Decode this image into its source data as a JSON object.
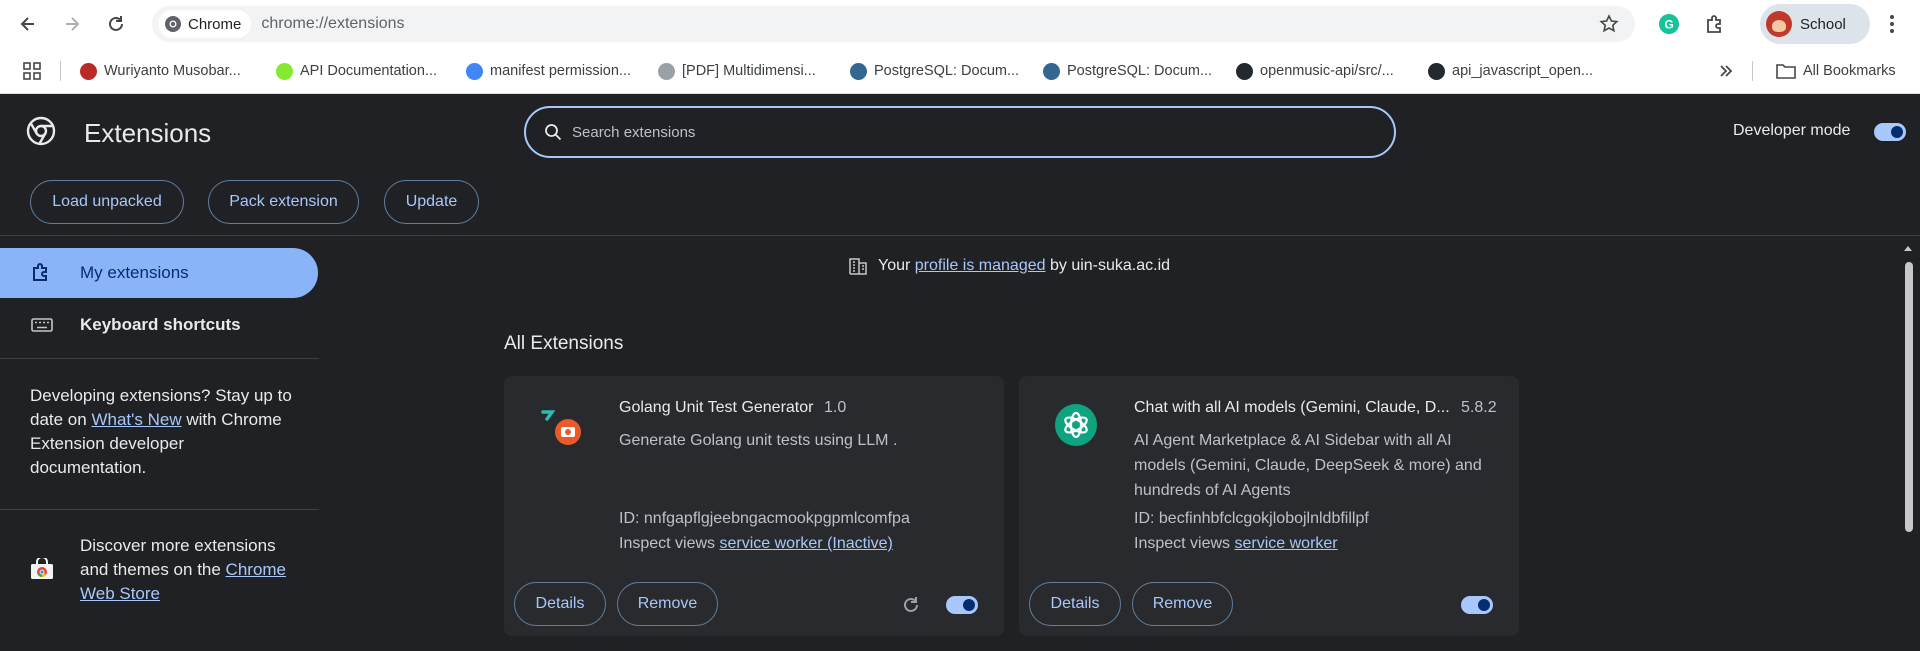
{
  "browser": {
    "chip_label": "Chrome",
    "url": "chrome://extensions",
    "profile_name": "School"
  },
  "bookmarks": [
    {
      "label": "Wuriyanto Musobar...",
      "icon": "quora-icon",
      "color": "#b92b27"
    },
    {
      "label": "API Documentation...",
      "icon": "api-icon",
      "color": "#85ea2d"
    },
    {
      "label": "manifest permission...",
      "icon": "google-icon",
      "color": "#4285f4"
    },
    {
      "label": "[PDF] Multidimensi...",
      "icon": "diamond-icon",
      "color": "#9aa0a6"
    },
    {
      "label": "PostgreSQL: Docum...",
      "icon": "postgres-icon",
      "color": "#336791"
    },
    {
      "label": "PostgreSQL: Docum...",
      "icon": "postgres-icon",
      "color": "#336791"
    },
    {
      "label": "openmusic-api/src/...",
      "icon": "github-icon",
      "color": "#24292f"
    },
    {
      "label": "api_javascript_open...",
      "icon": "github-icon",
      "color": "#24292f"
    }
  ],
  "all_bookmarks_label": "All Bookmarks",
  "header": {
    "title": "Extensions",
    "search_placeholder": "Search extensions",
    "developer_mode_label": "Developer mode",
    "developer_mode_on": true,
    "buttons": {
      "load_unpacked": "Load unpacked",
      "pack_extension": "Pack extension",
      "update": "Update"
    }
  },
  "sidebar": {
    "my_extensions": "My extensions",
    "keyboard_shortcuts": "Keyboard shortcuts",
    "dev_info_prefix": "Developing extensions? Stay up to date on ",
    "dev_info_link": "What's New",
    "dev_info_suffix": " with Chrome Extension developer documentation.",
    "store_prefix": "Discover more extensions and themes on the ",
    "store_link": "Chrome Web Store"
  },
  "managed": {
    "prefix": "Your ",
    "link": "profile is managed",
    "suffix": " by uin-suka.ac.id"
  },
  "section_title": "All Extensions",
  "extensions": [
    {
      "name": "Golang Unit Test Generator",
      "version": "1.0",
      "description": "Generate Golang unit tests using LLM .",
      "id_label": "ID: nnfgapflgjeebngacmookpgpmlcomfpa",
      "inspect_label": "Inspect views ",
      "inspect_link": "service worker (Inactive)",
      "details_label": "Details",
      "remove_label": "Remove",
      "enabled": true
    },
    {
      "name": "Chat with all AI models (Gemini, Claude, D...",
      "version": "5.8.2",
      "description": "AI Agent Marketplace & AI Sidebar with all AI models (Gemini, Claude, DeepSeek & more) and hundreds of AI Agents",
      "id_label": "ID: becfinhbfclcgokjlobojlnldbfillpf",
      "inspect_label": "Inspect views ",
      "inspect_link": "service worker",
      "details_label": "Details",
      "remove_label": "Remove",
      "enabled": true
    }
  ]
}
